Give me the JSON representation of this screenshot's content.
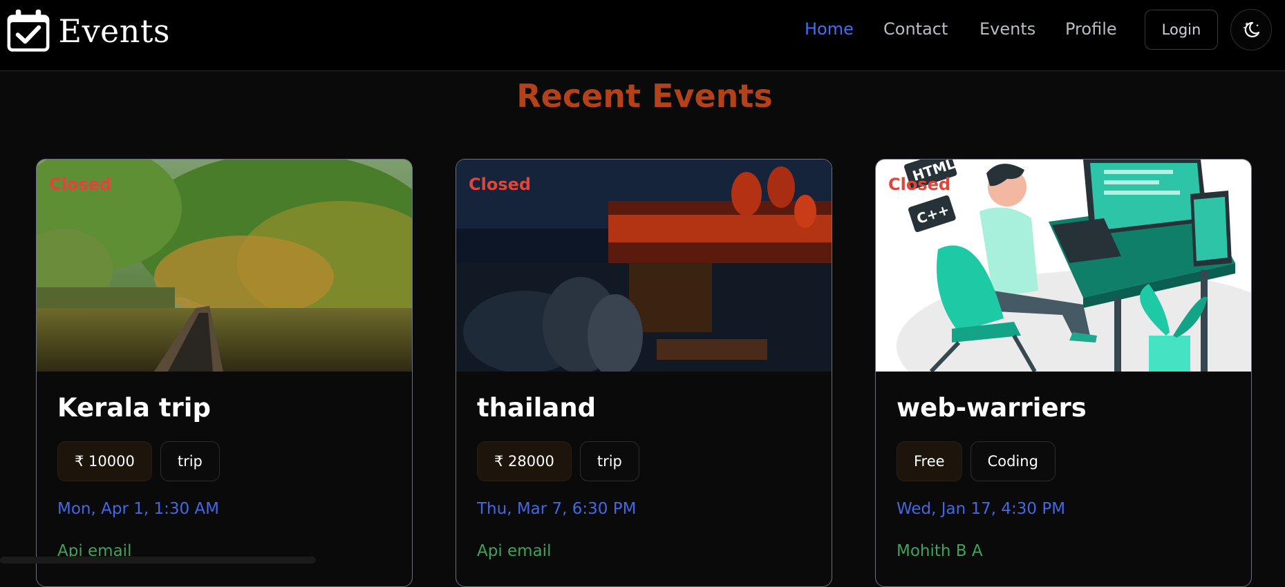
{
  "brand": {
    "name": "Events",
    "logo_icon": "calendar-check-icon"
  },
  "nav": {
    "links": [
      {
        "label": "Home",
        "active": true
      },
      {
        "label": "Contact",
        "active": false
      },
      {
        "label": "Events",
        "active": false
      },
      {
        "label": "Profile",
        "active": false
      }
    ],
    "login_label": "Login",
    "theme_icon": "moon-stars-icon"
  },
  "section": {
    "title": "Recent Events"
  },
  "events": [
    {
      "status": "Closed",
      "title": "Kerala trip",
      "price": "₹ 10000",
      "category": "trip",
      "date": "Mon, Apr 1, 1:30 AM",
      "host": "Api email"
    },
    {
      "status": "Closed",
      "title": "thailand",
      "price": "₹ 28000",
      "category": "trip",
      "date": "Thu, Mar 7, 6:30 PM",
      "host": "Api email"
    },
    {
      "status": "Closed",
      "title": "web-warriers",
      "price": "Free",
      "category": "Coding",
      "date": "Wed, Jan 17, 4:30 PM",
      "host": "Mohith B A",
      "image_text": [
        "HTML",
        "C++"
      ]
    }
  ],
  "colors": {
    "accent": "#3f6ff5",
    "section_title": "#b3421b",
    "closed": "#e0453a",
    "date": "#4169e6",
    "host": "#3fa45b"
  }
}
